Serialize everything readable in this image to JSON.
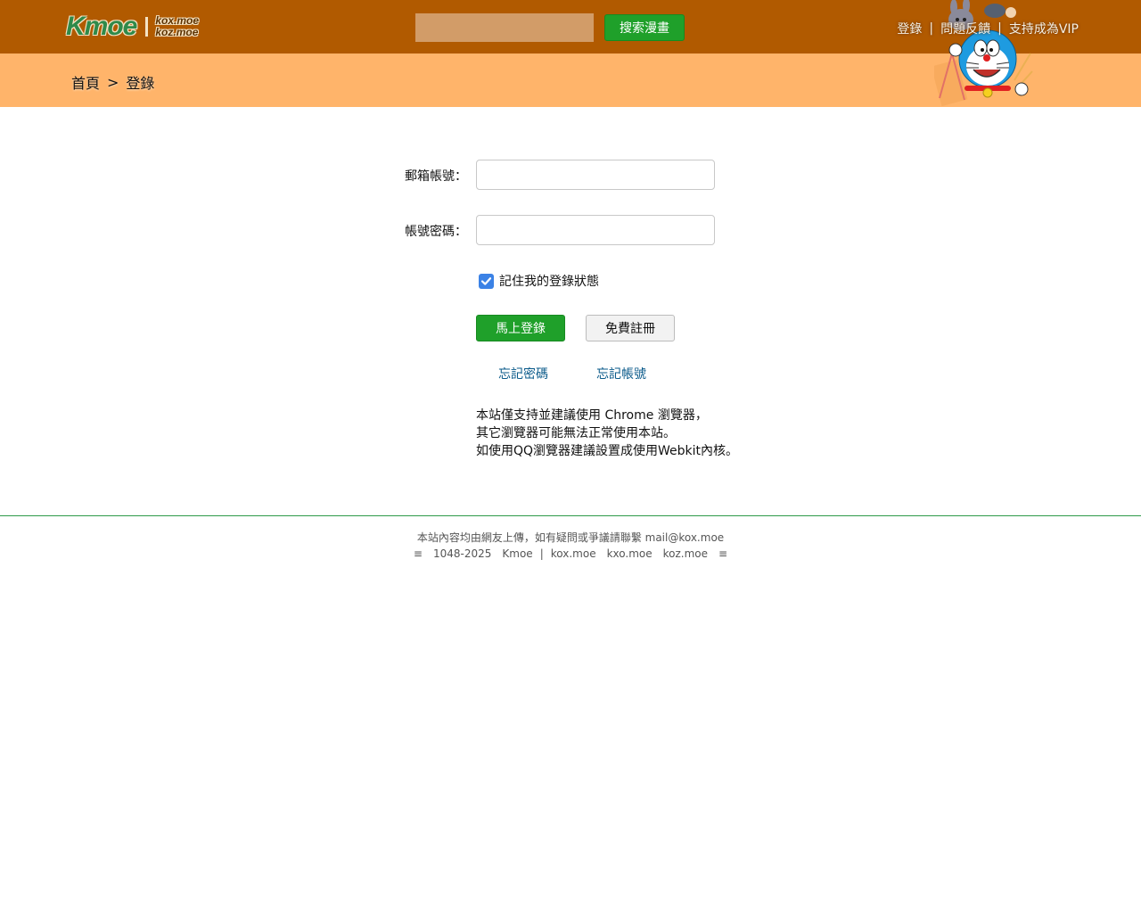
{
  "header": {
    "logo_main": "Kmoe",
    "logo_domains": [
      "kox.moe",
      "koz.moe"
    ],
    "search": {
      "placeholder": "",
      "value": ""
    },
    "search_button": "搜索漫畫",
    "links": [
      {
        "label": "登錄"
      },
      {
        "label": "問題反饋"
      },
      {
        "label": "支持成為VIP"
      }
    ],
    "link_separator": "|"
  },
  "breadcrumb": {
    "home": "首頁",
    "arrow": ">",
    "current": "登錄"
  },
  "login_form": {
    "email_label": "郵箱帳號：",
    "email_value": "",
    "password_label": "帳號密碼：",
    "password_value": "",
    "remember_label": "記住我的登錄狀態",
    "remember_checked": true,
    "login_button": "馬上登錄",
    "register_button": "免費註冊",
    "forgot_password": "忘記密碼",
    "forgot_account": "忘記帳號",
    "notice_lines": [
      "本站僅支持並建議使用 Chrome 瀏覽器，",
      "其它瀏覽器可能無法正常使用本站。",
      "如使用QQ瀏覽器建議設置成使用Webkit內核。"
    ]
  },
  "footer": {
    "disclaimer": "本站內容均由網友上傳，如有疑問或爭議請聯繫 mail@kox.moe",
    "menu_left": "≡",
    "years": "1048-2025",
    "site_name": "Kmoe",
    "divider": "|",
    "domains": [
      "kox.moe",
      "kxo.moe",
      "koz.moe"
    ],
    "menu_right": "≡"
  },
  "colors": {
    "topbar": "#b15a00",
    "breadcrumb_bar": "#ffb46a",
    "accent_green": "#1fa02a",
    "link_blue": "#0a5a8a",
    "footer_line": "#2e9a4a"
  }
}
